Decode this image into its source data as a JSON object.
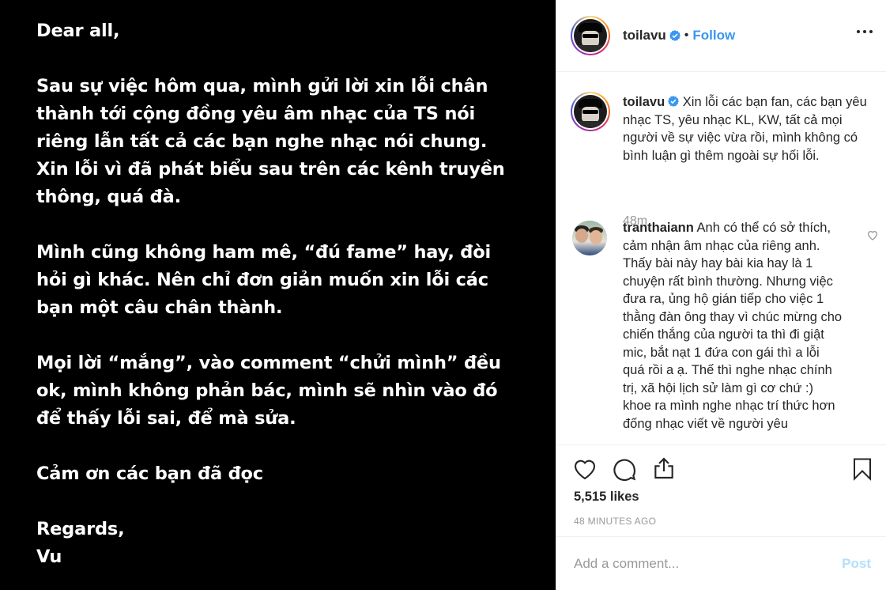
{
  "post": {
    "paragraphs": [
      "Dear all,",
      "Sau sự việc hôm qua, mình gửi lời xin lỗi chân\nthành tới cộng đồng yêu âm nhạc của TS nói\nriêng lẫn tất cả các bạn nghe nhạc nói chung.\nXin lỗi vì đã phát biểu sau trên các kênh truyền\nthông, quá đà.",
      "Mình cũng không ham mê, “đú fame” hay, đòi\nhỏi gì khác. Nên chỉ đơn giản muốn xin lỗi các\nbạn một câu chân thành.",
      "Mọi lời “mắng”, vào comment “chửi mình” đều\nok, mình không phản bác, mình sẽ nhìn vào đó\nđể thấy lỗi sai, để mà sửa.",
      "Cảm ơn các bạn đã đọc",
      "Regards,\nVu"
    ]
  },
  "header": {
    "username": "toilavu",
    "separator": "•",
    "follow_label": "Follow"
  },
  "caption": {
    "username": "toilavu",
    "text": "Xin lỗi các bạn fan, các bạn yêu nhạc TS, yêu nhạc KL, KW, tất cả mọi người về sự việc vừa rồi, mình không có bình luận gì thêm ngoài sự hối lỗi.",
    "time": "48m"
  },
  "comment": {
    "username": "tranthaiann",
    "text": "Anh có thể có sở thích, cảm nhận âm nhạc của riêng anh. Thấy bài này hay bài kia hay là 1 chuyện rất bình thường. Nhưng việc đưa ra, ủng hộ gián tiếp cho việc 1 thằng đàn ông thay vì chúc mừng cho chiến thắng của người ta thì đi giật mic, bắt nạt 1 đứa con gái thì a lỗi quá rồi a ạ. Thế thì nghe nhạc chính trị, xã hội lịch sử làm gì cơ chứ :) khoe ra mình nghe nhạc trí thức hơn đống nhạc viết về người yêu"
  },
  "stats": {
    "likes": "5,515 likes",
    "time_ago": "48 MINUTES AGO"
  },
  "comment_box": {
    "placeholder": "Add a comment...",
    "post_label": "Post"
  },
  "colors": {
    "accent": "#3897f0",
    "post_disabled": "#b2dffc",
    "muted": "#999999",
    "post_background": "#000000"
  }
}
